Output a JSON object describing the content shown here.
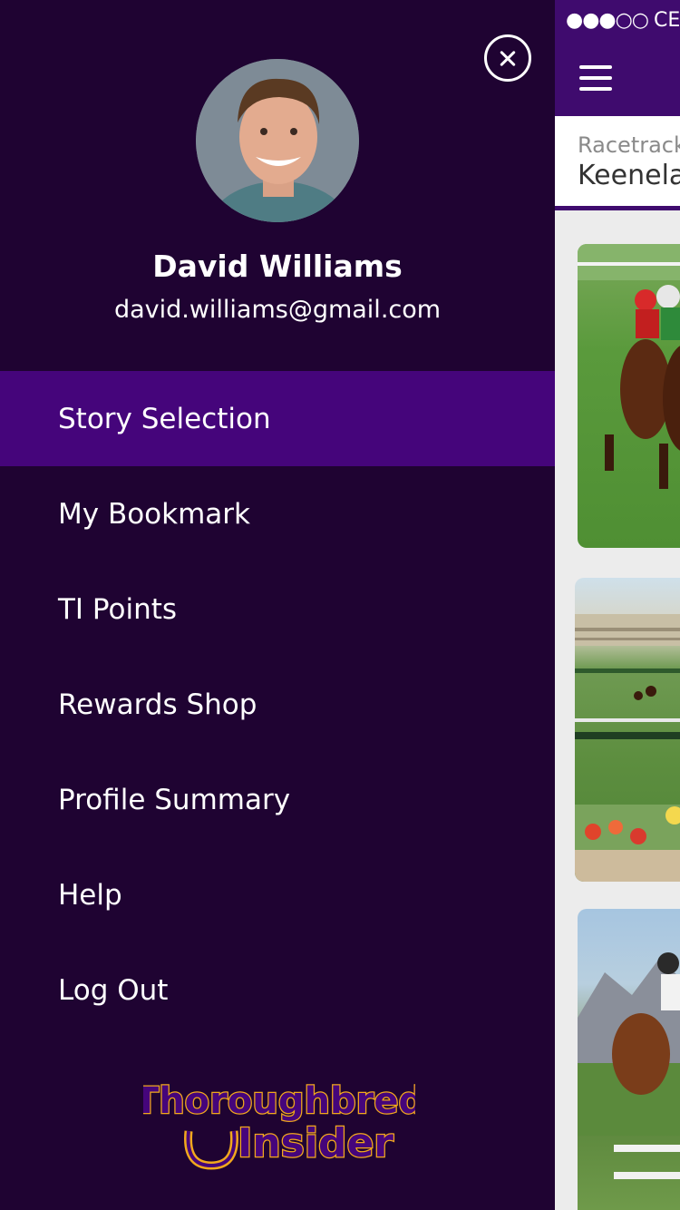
{
  "status_bar": {
    "signal": "●●●○○",
    "carrier": "CELL"
  },
  "filter": {
    "label": "Racetracks",
    "value": "Keeneland"
  },
  "user": {
    "name": "David Williams",
    "email": "david.williams@gmail.com"
  },
  "menu": [
    {
      "label": "Story Selection",
      "active": true
    },
    {
      "label": "My Bookmark"
    },
    {
      "label": "TI Points"
    },
    {
      "label": "Rewards Shop"
    },
    {
      "label": "Profile Summary"
    },
    {
      "label": "Help"
    },
    {
      "label": "Log Out"
    }
  ],
  "logo": {
    "line1": "Thoroughbred",
    "line2": "Insider"
  },
  "colors": {
    "drawer_bg": "#1f0332",
    "active_bg": "#45057b",
    "header_bg": "#3f0b6e",
    "logo_yellow": "#f2a81d"
  },
  "icons": {
    "close": "close-icon",
    "menu": "hamburger-icon"
  }
}
